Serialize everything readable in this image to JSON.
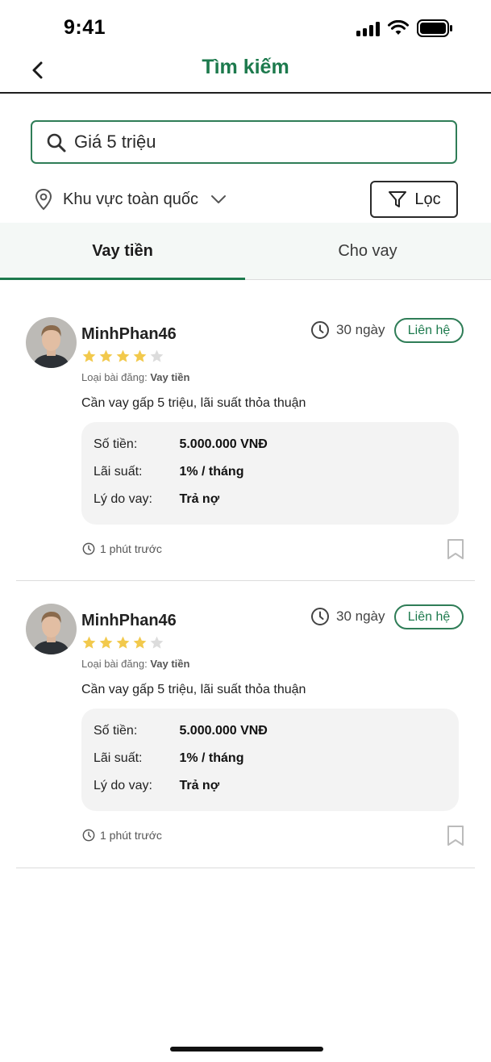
{
  "status_bar": {
    "time": "9:41"
  },
  "nav": {
    "title": "Tìm kiếm",
    "back_icon": "chevron-left-icon"
  },
  "search": {
    "value": "Giá 5 triệu",
    "icon": "search-icon"
  },
  "filters": {
    "region_label": "Khu vực toàn quốc",
    "filter_label": "Lọc"
  },
  "tabs": [
    {
      "label": "Vay tiền",
      "active": true
    },
    {
      "label": "Cho vay",
      "active": false
    }
  ],
  "posts": [
    {
      "username": "MinhPhan46",
      "rating": 4,
      "rating_max": 5,
      "post_type_label": "Loại bài đăng:",
      "post_type": "Vay tiền",
      "duration": "30 ngày",
      "contact_label": "Liên hệ",
      "description": "Cần vay gấp 5 triệu, lãi suất thỏa thuận",
      "details": [
        {
          "label": "Số tiền:",
          "value": "5.000.000 VNĐ"
        },
        {
          "label": "Lãi suất:",
          "value": "1% / tháng"
        },
        {
          "label": "Lý do vay:",
          "value": "Trả nợ"
        }
      ],
      "time_ago": "1 phút trước"
    },
    {
      "username": "MinhPhan46",
      "rating": 4,
      "rating_max": 5,
      "post_type_label": "Loại bài đăng:",
      "post_type": "Vay tiền",
      "duration": "30 ngày",
      "contact_label": "Liên hệ",
      "description": "Cần vay gấp 5 triệu, lãi suất thỏa thuận",
      "details": [
        {
          "label": "Số tiền:",
          "value": "5.000.000 VNĐ"
        },
        {
          "label": "Lãi suất:",
          "value": "1% / tháng"
        },
        {
          "label": "Lý do vay:",
          "value": "Trả nợ"
        }
      ],
      "time_ago": "1 phút trước"
    }
  ],
  "colors": {
    "accent": "#1d7a4d",
    "star": "#f2c94c",
    "star_empty": "#dcdcdc"
  }
}
